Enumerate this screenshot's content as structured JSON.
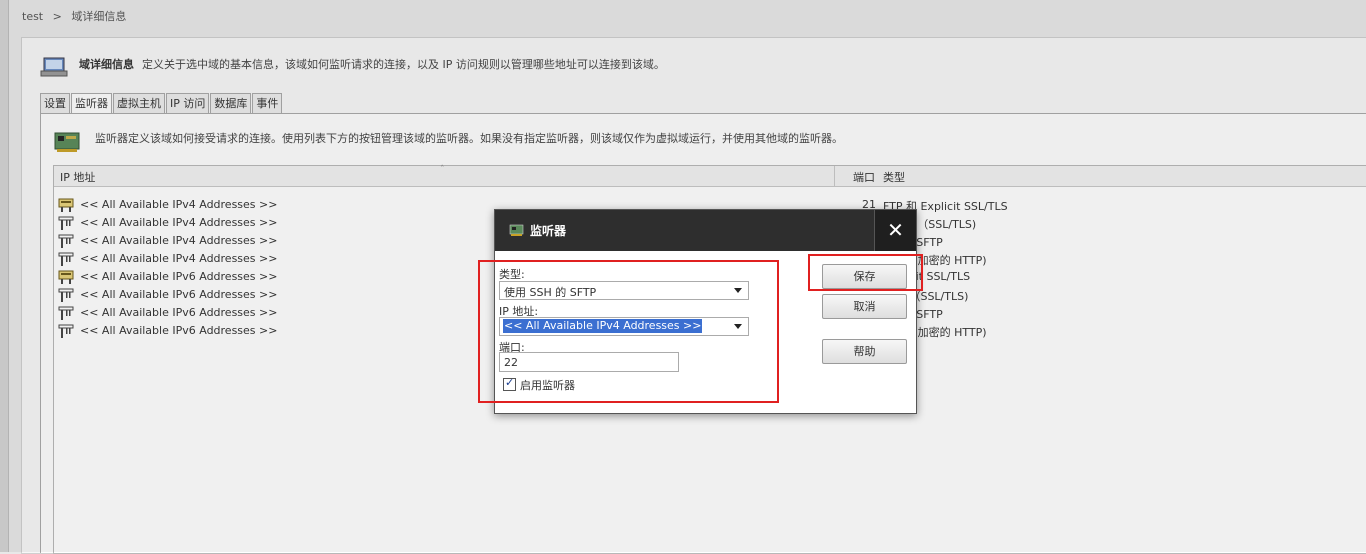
{
  "breadcrumb": [
    "test",
    ">",
    "域详细信息"
  ],
  "header": {
    "title": "域详细信息",
    "description": "定义关于选中域的基本信息，该域如何监听请求的连接，以及 IP 访问规则以管理哪些地址可以连接到该域。"
  },
  "tabs": [
    "设置",
    "监听器",
    "虚拟主机",
    "IP 访问",
    "数据库",
    "事件"
  ],
  "listeners": {
    "description": "监听器定义该域如何接受请求的连接。使用列表下方的按钮管理该域的监听器。如果没有指定监听器，则该域仅作为虚拟域运行，并使用其他域的监听器。",
    "columns": {
      "ip": "IP 地址",
      "port": "端口",
      "type": "类型"
    },
    "rows": [
      {
        "ip": "<< All Available IPv4 Addresses >>",
        "port": "21",
        "type": "FTP 和 Explicit SSL/TLS",
        "icon": "listener-ftp-icon"
      },
      {
        "ip": "<< All Available IPv4 Addresses >>",
        "port": "",
        "type": "t FTPS（SSL/TLS)",
        "icon": "listener-icon"
      },
      {
        "ip": "<< All Available IPv4 Addresses >>",
        "port": "",
        "type": "SH 的 SFTP",
        "icon": "listener-icon"
      },
      {
        "ip": "<< All Available IPv4 Addresses >>",
        "port": "",
        "type": "（SSL 加密的 HTTP)",
        "icon": "listener-icon"
      },
      {
        "ip": "<< All Available IPv6 Addresses >>",
        "port": "",
        "type": "Explicit SSL/TLS",
        "icon": "listener-ftp-icon"
      },
      {
        "ip": "<< All Available IPv6 Addresses >>",
        "port": "",
        "type": "FTPS（SSL/TLS)",
        "icon": "listener-icon"
      },
      {
        "ip": "<< All Available IPv6 Addresses >>",
        "port": "",
        "type": "SH 的 SFTP",
        "icon": "listener-icon"
      },
      {
        "ip": "<< All Available IPv6 Addresses >>",
        "port": "",
        "type": "（SSL 加密的 HTTP)",
        "icon": "listener-icon"
      }
    ]
  },
  "dialog": {
    "title": "监听器",
    "close": "✕",
    "type_label": "类型:",
    "type_value": "使用 SSH 的 SFTP",
    "ip_label": "IP 地址:",
    "ip_value": "<< All Available IPv4 Addresses >>",
    "port_label": "端口:",
    "port_value": "22",
    "enable_label": "启用监听器",
    "enable_checked": true,
    "save": "保存",
    "cancel": "取消",
    "help": "帮助"
  },
  "colors": {
    "dialog_titlebar": "#2e2e2e",
    "highlight_box": "#e02020",
    "selection": "#3b6fd1"
  }
}
